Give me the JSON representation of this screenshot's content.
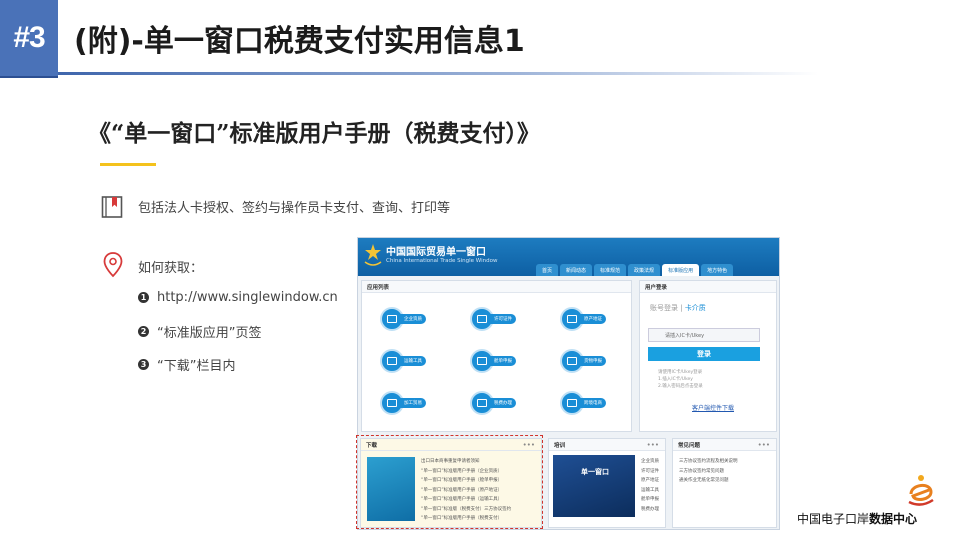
{
  "header": {
    "badge": "#3",
    "title": "(附)-单一窗口税费支付实用信息1"
  },
  "subtitle": "《“单一窗口”标准版用户手册（税费支付）》",
  "bullet": "包括法人卡授权、签约与操作员卡支付、查询、打印等",
  "how_to": {
    "label": "如何获取：",
    "steps": [
      {
        "num": "1",
        "text": "http://www.singlewindow.cn"
      },
      {
        "num": "2",
        "text": "“标准版应用”页签"
      },
      {
        "num": "3",
        "text": "“下载”栏目内"
      }
    ]
  },
  "screenshot": {
    "logo_title": "中国国际贸易单一窗口",
    "logo_sub": "China International Trade Single Window",
    "tabs": [
      "首页",
      "新闻动态",
      "标准规范",
      "政策法规",
      "标准版应用",
      "地方特色"
    ],
    "apps_header": "应用列表",
    "apps": [
      "企业资质",
      "许可证件",
      "原产地证",
      "运输工具",
      "舱单申报",
      "货物申报",
      "加工贸易",
      "税费办理",
      "跨境电商"
    ],
    "login_header": "用户登录",
    "login_tab1": "账号登录",
    "login_tab2": "卡介质",
    "login_card": "请插入IC卡/Ukey",
    "login_btn": "登录",
    "login_notes": [
      "请使用IC卡/Ukey登录",
      "1.插入IC卡/Ukey",
      "2.输入密码后点击登录"
    ],
    "login_link": "客户端控件下载",
    "download_header": "下载",
    "download_items": [
      "出口日本商事重复申请者须知",
      "“单一窗口”标准版用户手册（企业资质）",
      "“单一窗口”标准版用户手册（舱单申报）",
      "“单一窗口”标准版用户手册（原产地证）",
      "“单一窗口”标准版用户手册（运输工具）",
      "“单一窗口”标准版（税费支付）三方协议签约",
      "“单一窗口”标准版用户手册（税费支付）"
    ],
    "training_header": "培训",
    "training_img_text": "单一窗口",
    "training_items": [
      "企业资质",
      "许可证件",
      "原产地证",
      "运输工具",
      "舱单申报",
      "税费办理"
    ],
    "faq_header": "常见问题",
    "faq_items": [
      "三方协议签约流程及相关说明",
      "三方协议签约常见问题",
      "通关作业无纸化常见问题"
    ]
  },
  "footer": {
    "text_a": "中国电子口岸",
    "text_b": "数据中心"
  }
}
